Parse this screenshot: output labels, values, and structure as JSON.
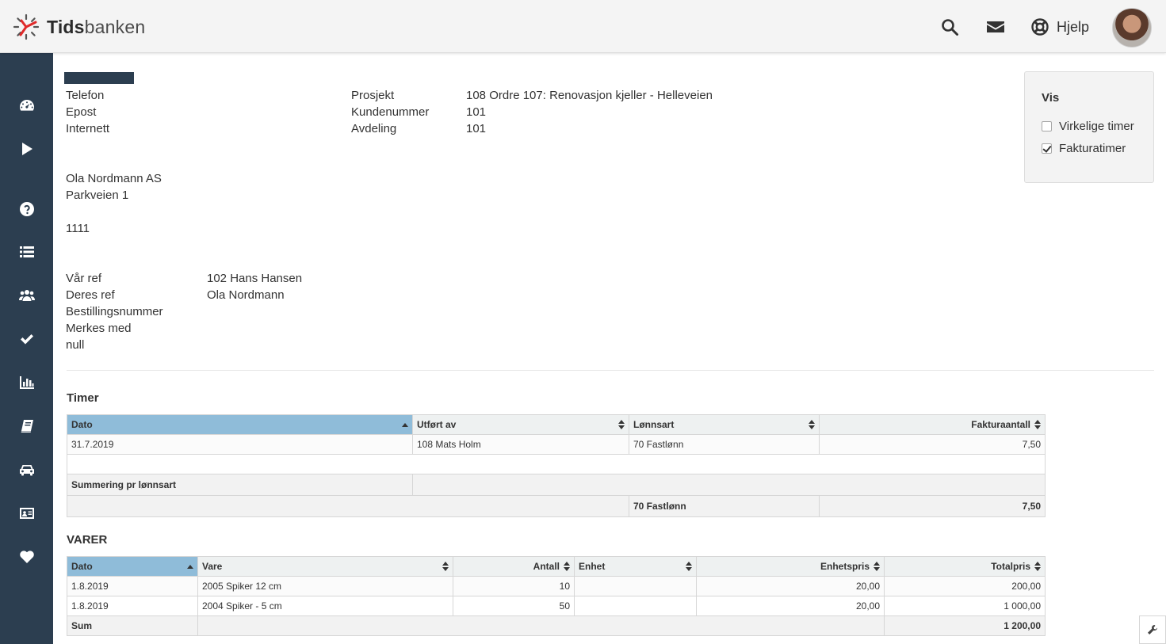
{
  "header": {
    "brand_bold": "Tids",
    "brand_rest": "banken",
    "help_label": "Hjelp",
    "icons": [
      "search-icon",
      "mail-icon",
      "lifebuoy-icon"
    ]
  },
  "sidebar": {
    "items": [
      "dashboard-icon",
      "play-icon",
      "question-icon",
      "list-icon",
      "users-icon",
      "check-icon",
      "bar-chart-icon",
      "book-icon",
      "car-icon",
      "id-card-icon",
      "heart-icon"
    ]
  },
  "contact": {
    "labels": [
      "Telefon",
      "Epost",
      "Internett"
    ]
  },
  "project_info": {
    "labels": [
      "Prosjekt",
      "Kundenummer",
      "Avdeling"
    ],
    "values": [
      "108 Ordre 107: Renovasjon kjeller - Helleveien",
      "101",
      "101"
    ]
  },
  "address": {
    "lines": [
      "Ola Nordmann AS",
      "Parkveien 1"
    ],
    "postal": "1111"
  },
  "references": {
    "labels": [
      "Vår ref",
      "Deres ref",
      "Bestillingsnummer",
      "Merkes med",
      "null"
    ],
    "values": [
      "102 Hans Hansen",
      "Ola Nordmann"
    ]
  },
  "vis": {
    "title": "Vis",
    "options": [
      {
        "label": "Virkelige timer",
        "checked": false
      },
      {
        "label": "Fakturatimer",
        "checked": true
      }
    ]
  },
  "timer": {
    "title": "Timer",
    "columns": [
      "Dato",
      "Utført av",
      "Lønnsart",
      "Fakturaantall"
    ],
    "rows": [
      [
        "31.7.2019",
        "108 Mats Holm",
        "70 Fastlønn",
        "7,50"
      ]
    ],
    "summary_title": "Summering pr lønnsart",
    "summary_row": [
      "70 Fastlønn",
      "7,50"
    ]
  },
  "varer": {
    "title": "VARER",
    "columns": [
      "Dato",
      "Vare",
      "Antall",
      "Enhet",
      "Enhetspris",
      "Totalpris"
    ],
    "rows": [
      [
        "1.8.2019",
        "2005 Spiker 12 cm",
        "10",
        "",
        "20,00",
        "200,00"
      ],
      [
        "1.8.2019",
        "2004 Spiker - 5 cm",
        "50",
        "",
        "20,00",
        "1 000,00"
      ]
    ],
    "sum_label": "Sum",
    "sum_value": "1 200,00"
  }
}
